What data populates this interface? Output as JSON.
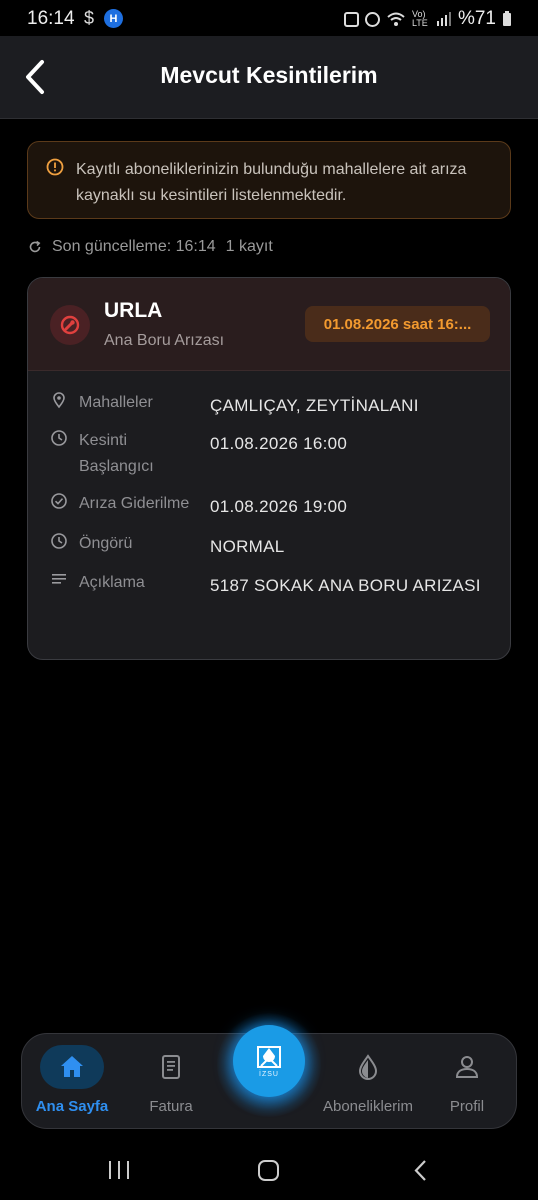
{
  "status_bar": {
    "time": "16:14",
    "dollar": "$",
    "h_badge": "H",
    "network": "Vo) LTE",
    "battery": "%71"
  },
  "header": {
    "title": "Mevcut Kesintilerim",
    "back_icon": "chevron-left-icon"
  },
  "notice": {
    "icon": "info-icon",
    "text": "Kayıtlı aboneliklerinizin bulunduğu mahallelere ait arıza kaynaklı su kesintileri listelenmektedir.",
    "accent": "#f0a040"
  },
  "update": {
    "icon": "refresh-icon",
    "last_update": "Son güncelleme: 16:14",
    "count": "1 kayıt"
  },
  "outage": {
    "title": "URLA",
    "subtitle": "Ana Boru Arızası",
    "badge": "01.08.2026 saat 16:...",
    "badge_color": "#f39a2f",
    "rows": [
      {
        "icon": "location-pin-icon",
        "label": "Mahalleler",
        "value": "ÇAMLIÇAY, ZEYTİNALANI"
      },
      {
        "icon": "clock-icon",
        "label": "Kesinti Başlangıcı",
        "value": "01.08.2026 16:00"
      },
      {
        "icon": "check-circle-icon",
        "label": "Arıza Giderilme",
        "value": "01.08.2026 19:00"
      },
      {
        "icon": "clock-icon",
        "label": "Öngörü",
        "value": "NORMAL"
      },
      {
        "icon": "notes-icon",
        "label": "Açıklama",
        "value": "5187 SOKAK ANA BORU ARIZASI"
      }
    ]
  },
  "bottom_nav": {
    "items": [
      {
        "label": "Ana Sayfa",
        "icon": "home-icon",
        "active": true
      },
      {
        "label": "Fatura",
        "icon": "invoice-icon",
        "active": false
      },
      {
        "label": "Aboneliklerim",
        "icon": "water-drop-icon",
        "active": false
      },
      {
        "label": "Profil",
        "icon": "person-icon",
        "active": false
      }
    ],
    "fab_text": "İZSU",
    "accent": "#1a9be6"
  }
}
